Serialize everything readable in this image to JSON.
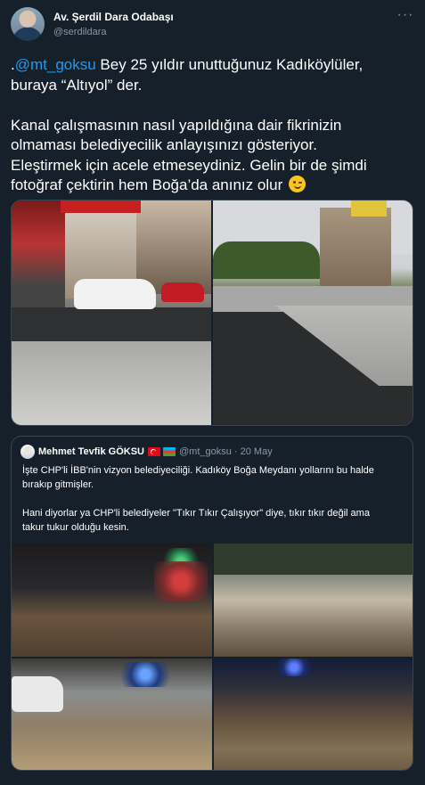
{
  "author": {
    "name": "Av. Şerdil Dara Odabaşı",
    "handle": "@serdildara"
  },
  "tweet": {
    "mention": "@mt_goksu",
    "line1_prefix": ".",
    "line1_rest": " Bey 25 yıldır unuttuğunuz Kadıköylüler,",
    "line2": "buraya “Altıyol” der.",
    "line3": "Kanal çalışmasının nasıl yapıldığına dair fikrinizin",
    "line4": "olmaması belediyecilik anlayışınızı gösteriyor.",
    "line5": "Eleştirmek için  acele etmeseydiniz. Gelin bir de şimdi",
    "line6": "fotoğraf çektirin hem Boğa’da anınız olur",
    "emoji": "wink-emoji"
  },
  "quote": {
    "name": "Mehmet Tevfik GÖKSU",
    "handle_date": "@mt_goksu · 20 May",
    "line1": "İşte CHP'li İBB'nin vizyon belediyeciliği. Kadıköy Boğa Meydanı yollarını bu halde",
    "line2": "bırakıp gitmişler.",
    "line3": "Hani diyorlar ya CHP'li belediyeler \"Tıkır Tıkır Çalışıyor\" diye, tıkır tıkır değil ama",
    "line4": "takur tukur olduğu kesin."
  },
  "colors": {
    "background": "#15202b",
    "mention": "#1d9bf0",
    "secondary_text": "#8899a6",
    "border": "#38444d"
  }
}
